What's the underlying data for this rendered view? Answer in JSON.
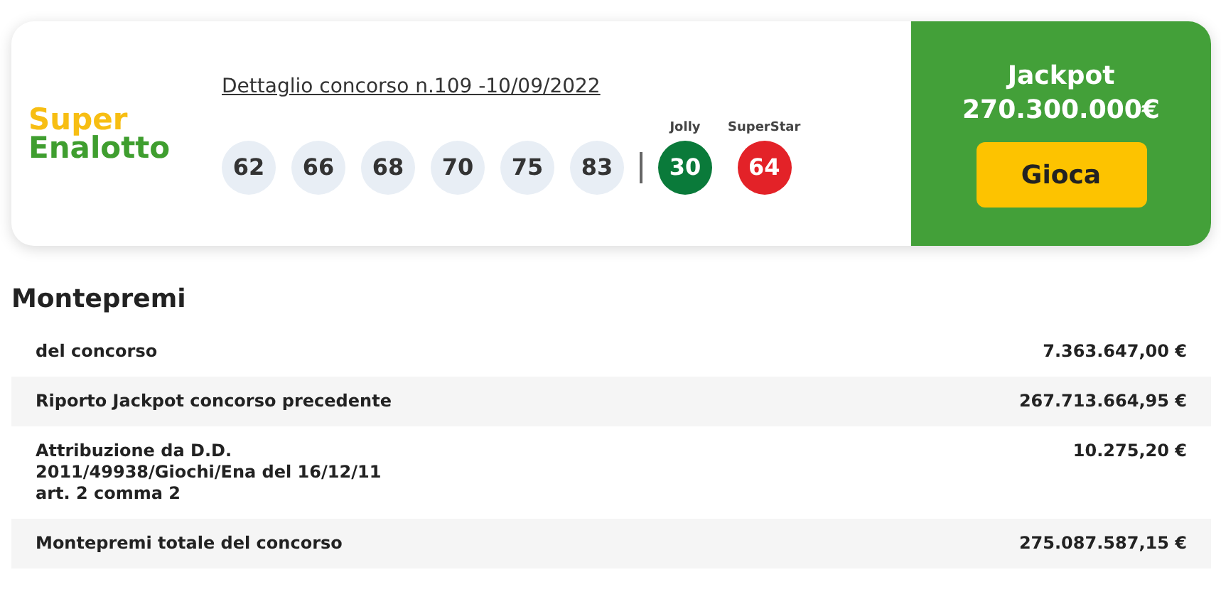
{
  "logo": {
    "line_1": "Super",
    "line_2": "Enalotto"
  },
  "draw_title": "Dettaglio concorso n.109 -10/09/2022",
  "balls": [
    {
      "kind": "number",
      "value": "62"
    },
    {
      "kind": "number",
      "value": "66"
    },
    {
      "kind": "number",
      "value": "68"
    },
    {
      "kind": "number",
      "value": "70"
    },
    {
      "kind": "number",
      "value": "75"
    },
    {
      "kind": "number",
      "value": "83"
    },
    {
      "kind": "special",
      "label": "Jolly",
      "value": "30",
      "color": "#0a7a3a"
    },
    {
      "kind": "special",
      "label": "SuperStar",
      "value": "64",
      "color": "#e32228"
    }
  ],
  "jackpot": {
    "label": "Jackpot",
    "amount": "270.300.000€",
    "button": "Gioca"
  },
  "prize_pool": {
    "title": "Montepremi",
    "rows": [
      {
        "label": "del concorso",
        "value": "7.363.647,00 €"
      },
      {
        "label": "Riporto Jackpot concorso precedente",
        "value": "267.713.664,95 €"
      },
      {
        "label": "Attribuzione da D.D.\n2011/49938/Giochi/Ena del 16/12/11\nart. 2 comma 2",
        "value": "10.275,20 €"
      },
      {
        "label": "Montepremi totale del concorso",
        "value": "275.087.587,15 €"
      }
    ]
  }
}
